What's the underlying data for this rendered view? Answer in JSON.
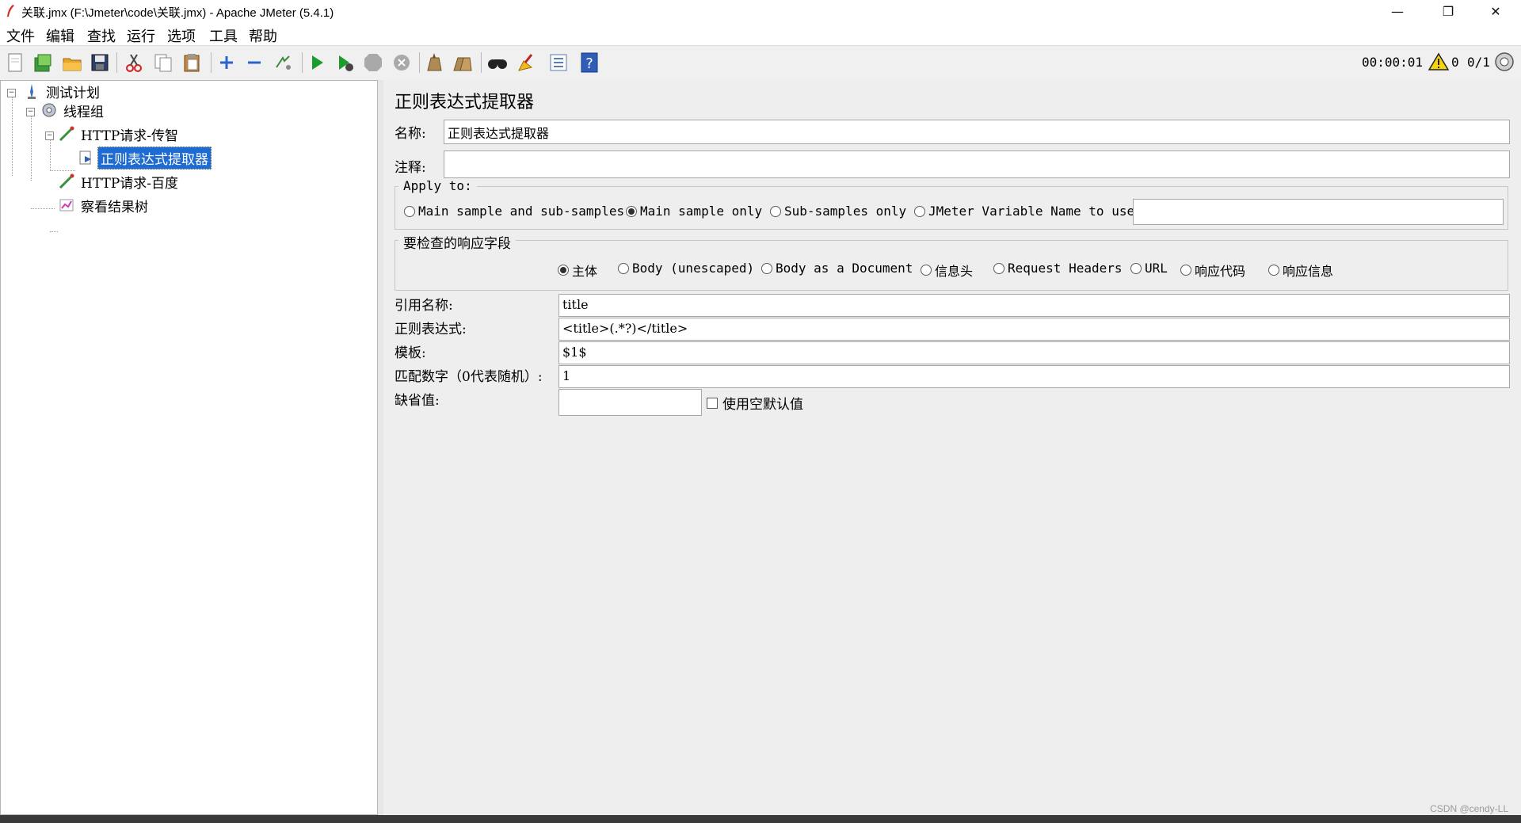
{
  "window": {
    "title": "关联.jmx (F:\\Jmeter\\code\\关联.jmx) - Apache JMeter (5.4.1)",
    "minimize": "—",
    "restore": "❐",
    "close": "✕"
  },
  "menu": [
    "文件",
    "编辑",
    "查找",
    "运行",
    "选项",
    "工具",
    "帮助"
  ],
  "toolbar": {
    "buttons": [
      "new-icon",
      "templates-icon",
      "open-icon",
      "save-icon",
      "cut-icon",
      "copy-icon",
      "paste-icon",
      "expand-icon",
      "collapse-icon",
      "toggle-icon",
      "start-icon",
      "start-no-pause-icon",
      "stop-icon",
      "shutdown-icon",
      "clear-icon",
      "clear-all-icon",
      "search-icon",
      "reset-search-icon",
      "function-helper-icon",
      "help-icon"
    ],
    "timer": "00:00:01",
    "warnings": "0",
    "threads": "0/1"
  },
  "tree": {
    "items": [
      {
        "label": "测试计划",
        "icon": "test-plan-icon"
      },
      {
        "label": "线程组",
        "icon": "thread-group-icon"
      },
      {
        "label": "HTTP请求-传智",
        "icon": "http-sampler-icon"
      },
      {
        "label": "正则表达式提取器",
        "icon": "extractor-icon",
        "selected": true
      },
      {
        "label": "HTTP请求-百度",
        "icon": "http-sampler-icon"
      },
      {
        "label": "察看结果树",
        "icon": "result-tree-icon"
      }
    ]
  },
  "panel": {
    "title": "正则表达式提取器",
    "name_label": "名称:",
    "name_value": "正则表达式提取器",
    "comment_label": "注释:",
    "comment_value": "",
    "apply_to": {
      "legend": "Apply to:",
      "options": [
        "Main sample and sub-samples",
        "Main sample only",
        "Sub-samples only",
        "JMeter Variable Name to use"
      ],
      "selected": 1,
      "variable_value": ""
    },
    "field_to_check": {
      "legend": "要检查的响应字段",
      "options": [
        "主体",
        "Body (unescaped)",
        "Body as a Document",
        "信息头",
        "Request Headers",
        "URL",
        "响应代码",
        "响应信息"
      ],
      "selected": 0
    },
    "ref_name_label": "引用名称:",
    "ref_name_value": "title",
    "regex_label": "正则表达式:",
    "regex_value": "<title>(.*?)</title>",
    "template_label": "模板:",
    "template_value": "$1$",
    "match_no_label": "匹配数字（0代表随机）:",
    "match_no_value": "1",
    "default_label": "缺省值:",
    "default_value": "",
    "use_empty_default_label": "使用空默认值",
    "use_empty_default_checked": false
  },
  "watermark": "CSDN @cendy-LL"
}
